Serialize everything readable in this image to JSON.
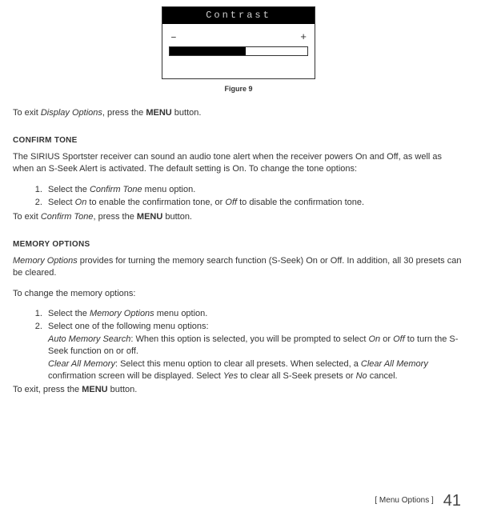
{
  "lcd": {
    "title": "Contrast",
    "minus": "–",
    "plus": "+"
  },
  "figure_caption": "Figure 9",
  "p_exit_display": {
    "pre": "To exit ",
    "itl": "Display Options",
    "mid": ", press the ",
    "bold": "MENU",
    "post": " button."
  },
  "s_confirm": {
    "head": "CONFIRM TONE",
    "intro": "The SIRIUS Sportster receiver can sound an audio tone alert when the receiver powers On and Off, as well as when an S-Seek Alert is activated. The default setting is On. To change the tone options:",
    "li1": {
      "pre": "Select the ",
      "itl": "Confirm Tone",
      "post": " menu option."
    },
    "li2": {
      "pre": "Select ",
      "itl1": "On",
      "mid": " to enable the confirmation tone, or ",
      "itl2": "Off",
      "post": " to disable the confirmation tone."
    },
    "exit": {
      "pre": "To exit ",
      "itl": "Confirm Tone",
      "mid": ", press the ",
      "bold": "MENU",
      "post": " button."
    }
  },
  "s_memory": {
    "head": "MEMORY OPTIONS",
    "intro": {
      "itl": "Memory Options",
      "post": " provides for turning the memory search function (S-Seek) On or Off. In addition, all 30 presets can be cleared."
    },
    "change": "To change the memory options:",
    "li1": {
      "pre": "Select the ",
      "itl": "Memory Options",
      "post": " menu option."
    },
    "li2_lead": "Select one of the following menu options:",
    "li2_a": {
      "itl1": "Auto Memory Search",
      "mid": ": When this option is selected, you will be prompted to select ",
      "itl2": "On",
      "mid2": " or ",
      "itl3": "Off",
      "post": " to turn the S-Seek function on or off."
    },
    "li2_b": {
      "itl1": "Clear All Memory",
      "mid": ": Select this menu option to clear all presets. When selected, a ",
      "itl2": "Clear All Memory",
      "mid2": " confirmation screen will be displayed. Select ",
      "itl3": "Yes",
      "mid3": " to clear all S-Seek presets or ",
      "itl4": "No",
      "post": " cancel."
    },
    "exit": {
      "pre": "To exit, press the ",
      "bold": "MENU",
      "post": " button."
    }
  },
  "footer": {
    "label": "[ Menu Options ]",
    "page": "41"
  },
  "chart_data": {
    "type": "bar",
    "title": "Contrast",
    "categories": [
      "Contrast"
    ],
    "values": [
      55
    ],
    "ylim": [
      0,
      100
    ],
    "xlabel": "– to +",
    "ylabel": ""
  }
}
